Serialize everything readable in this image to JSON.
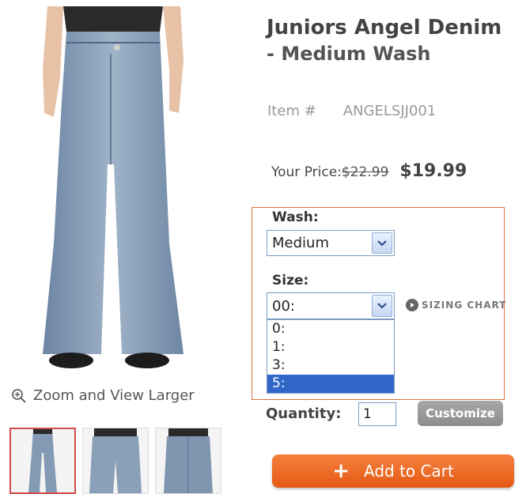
{
  "product": {
    "title": "Juniors Angel Denim",
    "subtitle": "- Medium Wash",
    "item_label": "Item  #",
    "item_number": "ANGELSJJ001",
    "price_label": "Your Price:",
    "old_price": "$22.99",
    "new_price": "$19.99"
  },
  "gallery": {
    "zoom_label": "Zoom and View Larger",
    "thumbnail_count": 3
  },
  "options": {
    "wash_label": "Wash:",
    "wash_value": "Medium",
    "size_label": "Size:",
    "size_value": "00:",
    "sizing_chart": "SIZING CHART",
    "size_options": [
      "0:",
      "1:",
      "3:",
      "5:"
    ],
    "size_highlighted": "5:"
  },
  "purchase": {
    "quantity_label": "Quantity:",
    "quantity_value": "1",
    "customize_label": "Customize",
    "add_to_cart_label": "Add to Cart"
  },
  "colors": {
    "accent_orange": "#e55a13",
    "options_border": "#e07040",
    "selection_blue": "#3166c9"
  }
}
